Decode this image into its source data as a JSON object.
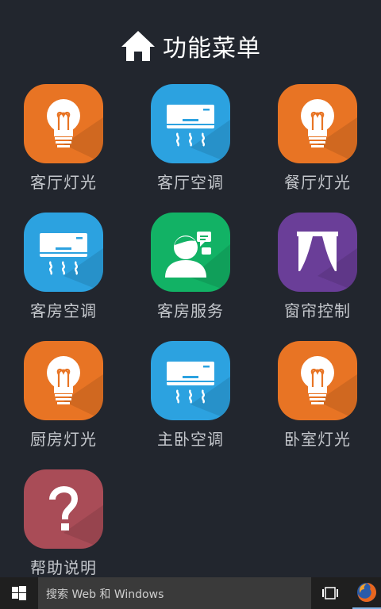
{
  "header": {
    "title": "功能菜单",
    "icon": "home-icon"
  },
  "menu": {
    "items": [
      {
        "label": "客厅灯光",
        "icon": "lightbulb-icon",
        "color": "#e87424"
      },
      {
        "label": "客厅空调",
        "icon": "air-conditioner-icon",
        "color": "#2ca2e0"
      },
      {
        "label": "餐厅灯光",
        "icon": "lightbulb-icon",
        "color": "#e87424"
      },
      {
        "label": "客房空调",
        "icon": "air-conditioner-icon",
        "color": "#2ca2e0"
      },
      {
        "label": "客房服务",
        "icon": "customer-service-icon",
        "color": "#12b265"
      },
      {
        "label": "窗帘控制",
        "icon": "curtain-icon",
        "color": "#6a3e98"
      },
      {
        "label": "厨房灯光",
        "icon": "lightbulb-icon",
        "color": "#e87424"
      },
      {
        "label": "主卧空调",
        "icon": "air-conditioner-icon",
        "color": "#2ca2e0"
      },
      {
        "label": "卧室灯光",
        "icon": "lightbulb-icon",
        "color": "#e87424"
      },
      {
        "label": "帮助说明",
        "icon": "question-icon",
        "color": "#a94c57"
      }
    ]
  },
  "taskbar": {
    "search_placeholder": "搜索 Web 和 Windows",
    "start_icon": "windows-logo-icon",
    "task_view_icon": "task-view-icon",
    "firefox_icon": "firefox-icon"
  }
}
